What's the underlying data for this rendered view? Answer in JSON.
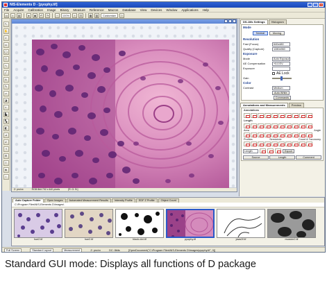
{
  "window": {
    "title": "NIS-Elements D - [pyophy.tif]",
    "colors": {
      "titlebar": "#1b49b8",
      "accent": "#2b58c9"
    }
  },
  "menu": [
    "File",
    "Acquire",
    "Calibration",
    "Image",
    "Binary",
    "Measure",
    "Reference",
    "Macros",
    "Database",
    "View",
    "Devices",
    "Window",
    "Applications",
    "Help"
  ],
  "toolbar": {
    "zoom": "100%",
    "layout_label": "Customize"
  },
  "document": {
    "status": [
      "Z: pro/xx",
      "RGB 8bit  792 x 640 pixels",
      "[R: G: B:]"
    ]
  },
  "right_panel": {
    "tabs": [
      "DS-1Mc Settings",
      "Histogram"
    ],
    "mode": {
      "header": "Mode",
      "buttons": [
        "Normal",
        "Moving"
      ]
    },
    "resolution": {
      "header": "Resolution",
      "rows": [
        {
          "label": "Fast (Focus)",
          "value": "640x480"
        },
        {
          "label": "Quality (Capture)",
          "value": "1280x960"
        }
      ]
    },
    "exposure": {
      "header": "Exposure",
      "rows": [
        {
          "label": "Mode",
          "value": "Auto Exposure"
        },
        {
          "label": "AE Compensation",
          "value": "+0.0 EV"
        },
        {
          "label": "Exposure",
          "value": ""
        }
      ],
      "ae_lock": "AE Lock",
      "gain_label": "Gain"
    },
    "color": {
      "header": "Color",
      "contrast_label": "Contrast",
      "contrast_value": "Medium",
      "auto_white": "Auto White"
    },
    "commands_label": "Commands"
  },
  "annotations": {
    "tabs": [
      "Annotations and Measurements",
      "Preview"
    ],
    "group_labels": [
      "Annotations",
      "Length",
      "Area",
      "Angle",
      "Profiles",
      "Semicircle",
      "Count & Taxonomy"
    ],
    "length_dd": "Length",
    "export_label": "Export",
    "source_buttons": [
      "Source",
      "Length",
      "Comment"
    ]
  },
  "bottom": {
    "tabs": [
      "Auto Capture Folder",
      "Open Images",
      "Automated Measurement Results",
      "Intensity Profile",
      "EDF Z Profile",
      "Object Count"
    ],
    "path": "C:\\Program Files\\NIS-Elements D\\Images\\",
    "thumbnails": [
      "hue2.tif",
      "hue2.tif",
      "black-dot.tif",
      "pyophy.tif",
      "jaws2f.tif",
      "musicle2.tif"
    ],
    "status_tabs": [
      "Full Screen",
      "Standard Layout",
      "Measurement"
    ],
    "status_text": [
      "Z: pro/xx",
      "DC: 8bits",
      "[OpenDocument(\"C:\\Program Files\\NIS-Elements D\\Images\\pyophy.tif\", 0)]"
    ]
  },
  "caption": "Standard GUI mode: Displays all functions of D package"
}
